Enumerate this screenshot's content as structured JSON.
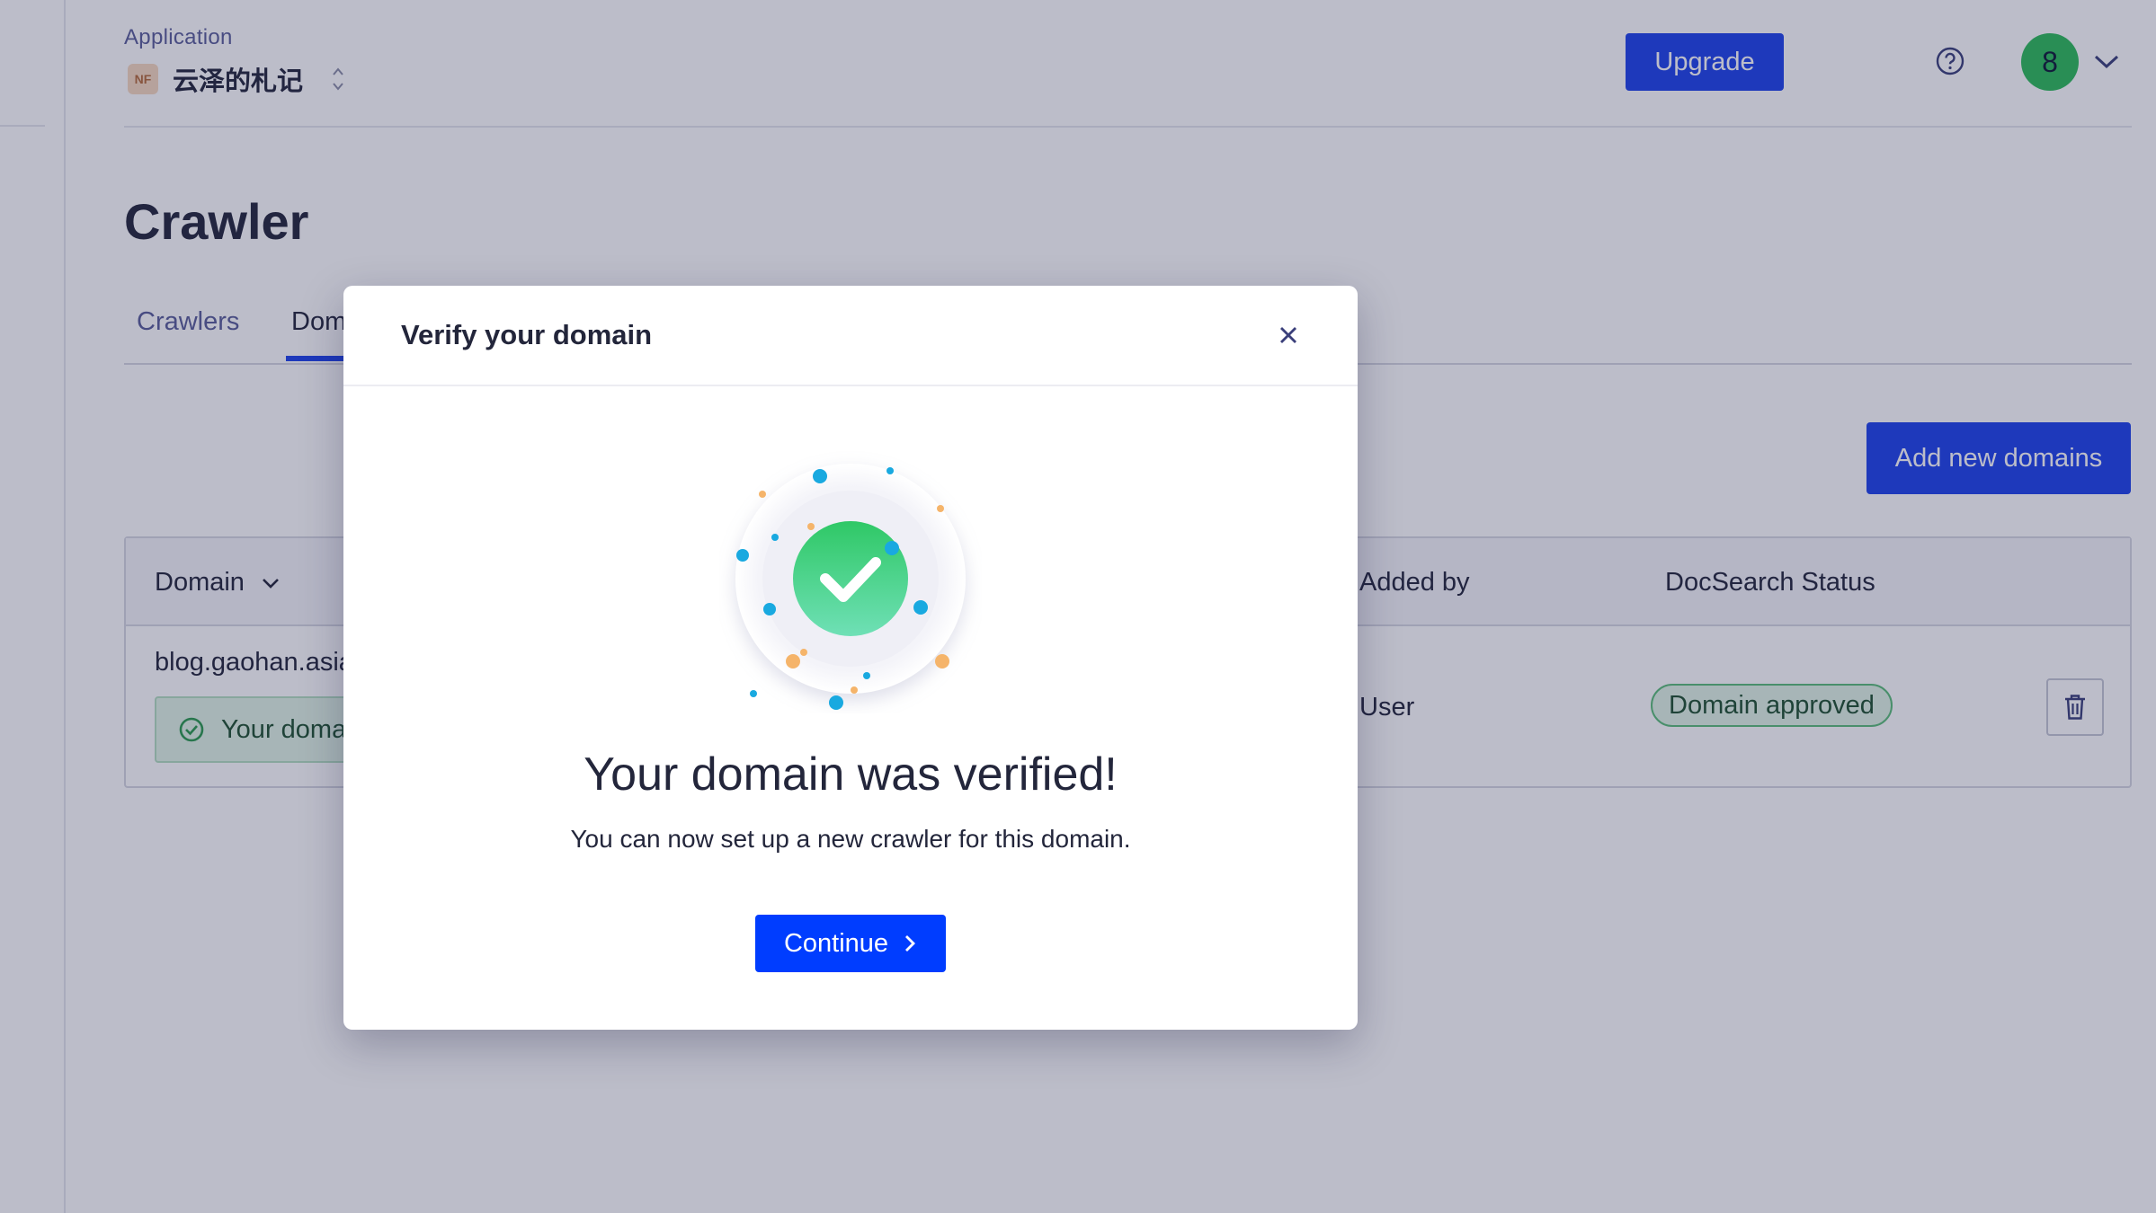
{
  "header": {
    "app_label": "Application",
    "app_badge": "NF",
    "app_name": "云泽的札记",
    "upgrade_label": "Upgrade",
    "avatar_initial": "8"
  },
  "page": {
    "title": "Crawler",
    "tabs": [
      {
        "label": "Crawlers"
      },
      {
        "label": "Dom"
      }
    ],
    "add_button_label": "Add new domains"
  },
  "table": {
    "columns": {
      "domain": "Domain",
      "added_by": "Added by",
      "docsearch_status": "DocSearch Status"
    },
    "rows": [
      {
        "domain": "blog.gaohan.asia",
        "verified_note": "Your doma",
        "added_by": "User",
        "status": "Domain approved"
      }
    ]
  },
  "modal": {
    "title": "Verify your domain",
    "heading": "Your domain was verified!",
    "description": "You can now set up a new crawler for this domain.",
    "continue_label": "Continue"
  },
  "colors": {
    "primary": "#1d42eb",
    "continue": "#003dff",
    "success": "#2dbc5a",
    "confetti_blue": "#19a9e0",
    "confetti_orange": "#f5b46a"
  },
  "icons": {
    "help": "question-circle-icon",
    "close": "close-icon",
    "check": "check-icon",
    "trash": "trash-icon",
    "chevron_down": "chevron-down-icon",
    "chevron_right": "chevron-right-icon",
    "updown": "updown-chevrons-icon"
  }
}
